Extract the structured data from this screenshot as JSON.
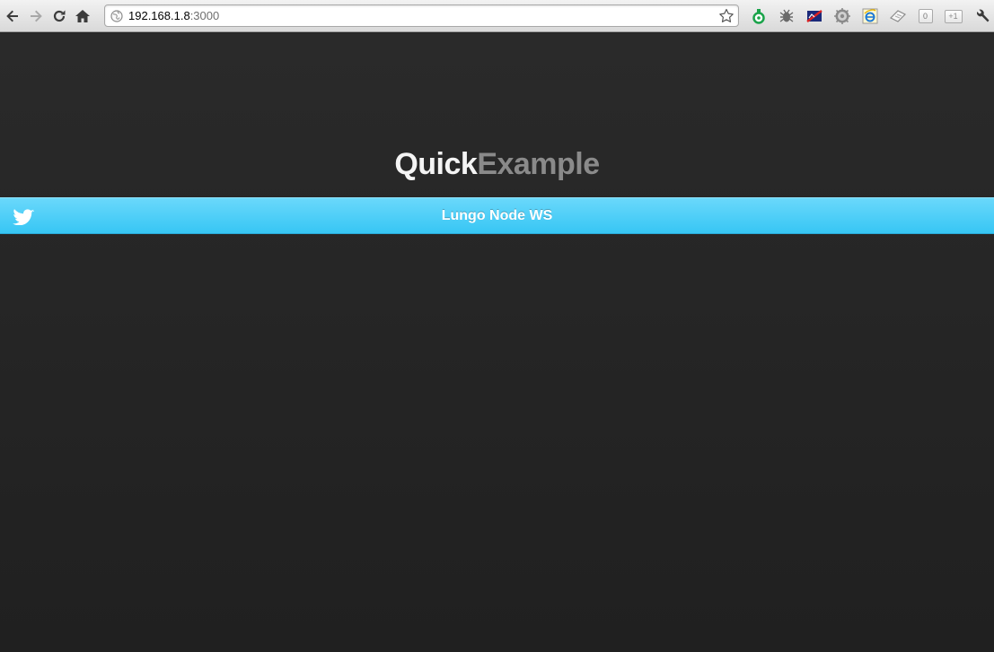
{
  "browser": {
    "url_host": "192.168.1.8",
    "url_port": ":3000",
    "nav_icons": [
      "back-arrow-icon",
      "forward-arrow-icon",
      "reload-icon",
      "home-icon"
    ],
    "extension_icons": [
      "green-extension-icon",
      "bug-extension-icon",
      "flag-extension-icon",
      "gear-extension-icon",
      "ie-tab-icon",
      "paper-extension-icon",
      "counter-badge-icon",
      "plus-one-icon",
      "wrench-icon"
    ],
    "counter_badge": "0",
    "plusone_label": "+1"
  },
  "app": {
    "logo_part1": "Quick",
    "logo_part2": "Example",
    "header_title": "Lungo Node WS",
    "header_icon": "twitter-bird-icon",
    "colors": {
      "background": "#242424",
      "header_blue": "#4fd0f8",
      "logo_white": "#f4f4f4",
      "logo_gray": "#8a8a8a"
    }
  }
}
